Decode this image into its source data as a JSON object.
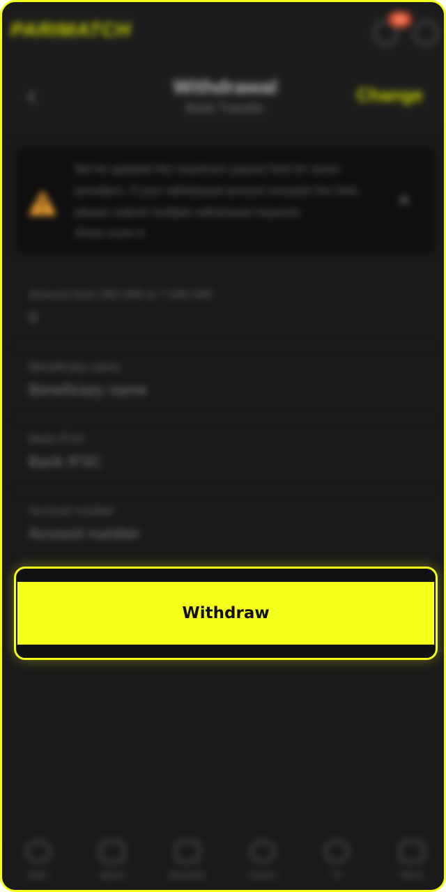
{
  "app": {
    "logo_text": "PARIMATCH"
  },
  "topbar": {
    "notification_badge": "99"
  },
  "header": {
    "title": "Withdrawal",
    "subtitle": "Bank Transfer",
    "change_label": "Change"
  },
  "notice": {
    "text": "We've updated the maximum payout limit for some providers. If your withdrawal amount exceeds the limit, please submit multiple withdrawal requests.",
    "show_more": "Show more",
    "warning_icon_color": "#f0a030"
  },
  "form": {
    "fields": [
      {
        "label": "Amount from 300 INR to 7 000 INR",
        "value": "0"
      },
      {
        "label": "Beneficiary name",
        "value": "Beneficiary name"
      },
      {
        "label": "Bank IFSC",
        "value": "Bank IFSC"
      },
      {
        "label": "Account number",
        "value": "Account number"
      }
    ]
  },
  "withdraw_button": {
    "label": "Withdraw",
    "color": "#f4ff1a"
  },
  "bottom_nav": {
    "items": [
      {
        "label": "Main",
        "icon": "home-icon"
      },
      {
        "label": "Sports",
        "icon": "sports-icon"
      },
      {
        "label": "Rewards",
        "icon": "gift-icon"
      },
      {
        "label": "Casino",
        "icon": "casino-icon"
      },
      {
        "label": "TV",
        "icon": "tv-icon"
      },
      {
        "label": "Menu",
        "icon": "menu-icon"
      }
    ]
  }
}
